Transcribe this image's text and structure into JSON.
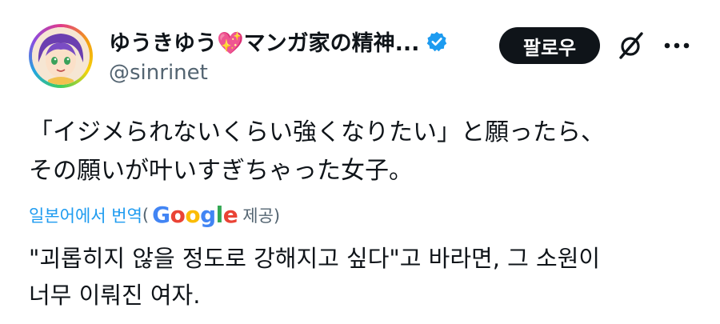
{
  "user": {
    "display_name": "ゆうきゆう💖マンガ家の精神...",
    "handle": "@sinrinet",
    "verified_color": "#1d9bf0"
  },
  "actions": {
    "follow_label": "팔로우",
    "grok_icon": "grok-slash-icon",
    "more_icon": "more-dots-icon"
  },
  "post": {
    "lines": [
      "「イジメられないくらい強くなりたい」と願ったら、",
      "その願いが叶いすぎちゃった女子。"
    ]
  },
  "translation": {
    "label": "일본어에서 번역",
    "open_paren": "(",
    "google_letters": [
      "G",
      "o",
      "o",
      "g",
      "l",
      "e"
    ],
    "suffix": "제공)",
    "lines": [
      "\"괴롭히지 않을 정도로 강해지고 싶다\"고 바라면, 그 소원이",
      "너무 이뤄진 여자."
    ]
  }
}
